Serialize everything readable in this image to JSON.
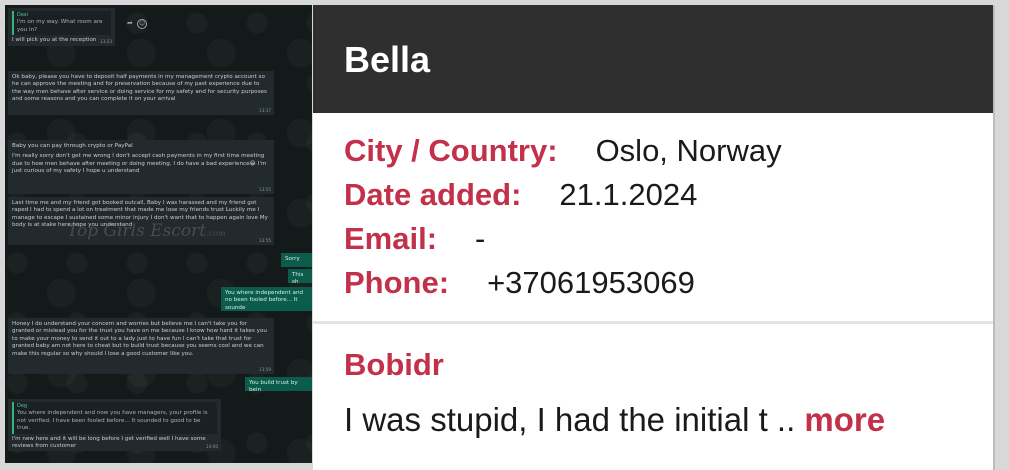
{
  "chat": {
    "watermark": "Top Girls Escort",
    "watermark_suffix": ".com",
    "messages": [
      {
        "quote_name": "Desi",
        "quote": "I'm on my way. What room are you in?",
        "text": "I will pick you at the reception",
        "time": "13:23"
      },
      {
        "text": "Ok baby, please you have to deposit half payments in my management crypto account so he can approve the meeting and for preservation because of my past experience due to the way men behave after service or doing service for my safety and for security purposes and some reasons and you can complete it on your arrival",
        "time": "13:37"
      },
      {
        "p1": "Baby you can pay through crypto or PayPal",
        "p2": "I'm really sorry don't get me wrong I don't accept cash payments in my first time meeting due to how men behave after meeting or doing meeting. I do have a bad experience😂 I'm just curious of my safety I hope u understand",
        "time": "13:55"
      },
      {
        "text": "Last time me and my friend got booked outcall, Baby I was harassed and my friend got raped I had to spend a lot on treatment that made me lose my friends trust Luckily me I manage to escape I sustained some minor injury I don't want that to happen again love My body is at stake here,hope you understand",
        "time": "13:55"
      },
      {
        "text": "Sorry",
        "time": ""
      },
      {
        "text": "This sh",
        "time": ""
      },
      {
        "text": "You where independent and no been fooled before... It sounde",
        "time": ""
      },
      {
        "text": "Honey I do understand your concern and worries but believe me I can't take you for granted or mislead you for the trust you have on me because I know how hard it takes you to make your money to send it out to a lady just to have fun I can't take that trust for granted baby am not here to cheat but to build trust because you seems cool and we can make this regular so why should I lose a good customer like you.",
        "time": "13:59"
      },
      {
        "text": "You build trust by bein",
        "time": ""
      },
      {
        "quote_name": "Deg",
        "quote": "You where independent and now you have managers, your profile is not verified. I have been fooled before... It sounded to good to be true.",
        "text": "I'm new here and it will be long before I get verified well I have some reviews from customer",
        "time": "14:00"
      }
    ]
  },
  "profile": {
    "name": "Bella",
    "city_label": "City / Country:",
    "city_value": "Oslo, Norway",
    "date_label": "Date added:",
    "date_value": "21.1.2024",
    "email_label": "Email:",
    "email_value": "-",
    "phone_label": "Phone:",
    "phone_value": "+37061953069"
  },
  "review": {
    "author": "Bobidr",
    "text": "I was stupid, I had the initial t .. ",
    "more_label": "more"
  },
  "colors": {
    "accent": "#c2304a",
    "header_bg": "#2f2f2f",
    "chat_bg": "#14191a",
    "bubble_out": "#0b5c4b"
  }
}
